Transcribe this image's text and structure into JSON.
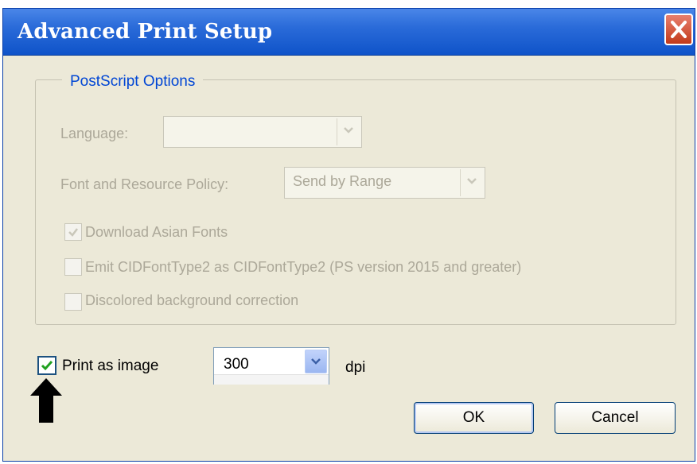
{
  "dialog": {
    "title": "Advanced Print Setup",
    "close_icon": "close-icon"
  },
  "postscript": {
    "group_title": "PostScript Options",
    "language_label": "Language:",
    "language_value": "",
    "font_policy_label": "Font and Resource Policy:",
    "font_policy_value": "Send by Range",
    "checkboxes": [
      {
        "label": "Download Asian Fonts",
        "checked": true,
        "enabled": false
      },
      {
        "label": "Emit CIDFontType2 as CIDFontType2 (PS version 2015 and greater)",
        "checked": false,
        "enabled": false
      },
      {
        "label": "Discolored background correction",
        "checked": false,
        "enabled": false
      }
    ]
  },
  "print_as_image": {
    "label": "Print as image",
    "checked": true,
    "dpi_value": "300",
    "dpi_unit": "dpi"
  },
  "buttons": {
    "ok": "OK",
    "cancel": "Cancel"
  },
  "annotation": {
    "arrow_icon": "up-arrow-icon"
  },
  "colors": {
    "titlebar": "#0f53c9",
    "dialog_bg": "#ece9d8",
    "group_title": "#0046d5",
    "disabled_text": "#aca899",
    "check_green": "#21a121"
  }
}
